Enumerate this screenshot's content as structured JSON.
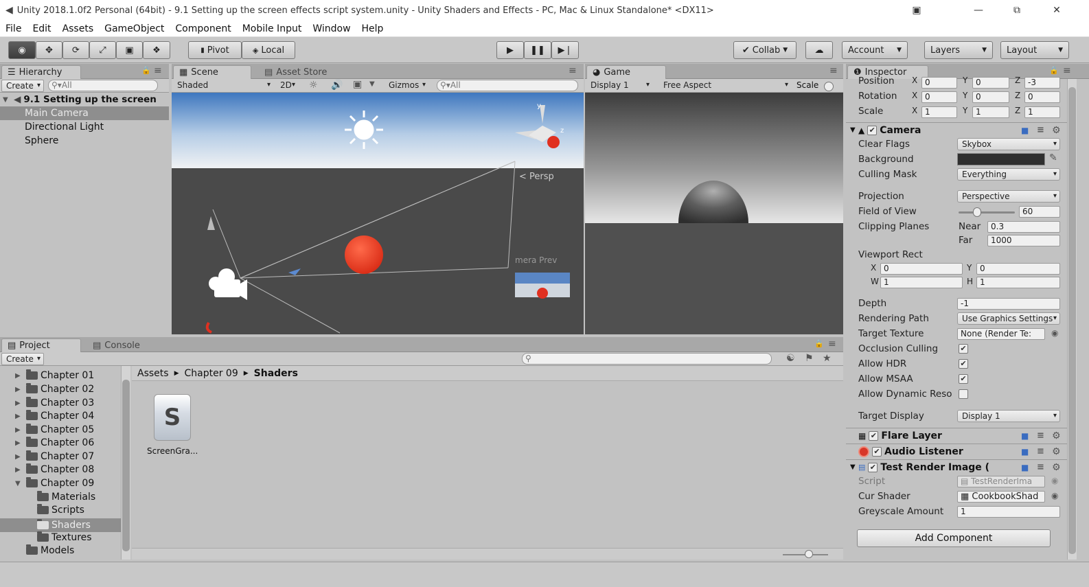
{
  "window": {
    "title": "Unity 2018.1.0f2 Personal (64bit) - 9.1 Setting up the screen effects script system.unity - Unity Shaders and Effects - PC, Mac & Linux Standalone* <DX11>"
  },
  "menu": [
    "File",
    "Edit",
    "Assets",
    "GameObject",
    "Component",
    "Mobile Input",
    "Window",
    "Help"
  ],
  "toolbar": {
    "pivot": "Pivot",
    "local": "Local",
    "collab": "Collab",
    "account": "Account",
    "layers": "Layers",
    "layout": "Layout"
  },
  "hierarchy": {
    "tab": "Hierarchy",
    "create": "Create",
    "search_placeholder": "All",
    "scene_name": "9.1 Setting up the screen",
    "items": [
      "Main Camera",
      "Directional Light",
      "Sphere"
    ]
  },
  "scene": {
    "tab": "Scene",
    "asset_store_tab": "Asset Store",
    "shading": "Shaded",
    "mode_2d": "2D",
    "gizmos": "Gizmos",
    "search_placeholder": "All",
    "persp_label": "Persp",
    "camera_preview_label": "mera Prev"
  },
  "game": {
    "tab": "Game",
    "display": "Display 1",
    "aspect": "Free Aspect",
    "scale": "Scale"
  },
  "inspector": {
    "tab": "Inspector",
    "transform": {
      "position_label": "Position",
      "position": [
        "0",
        "0",
        "-3"
      ],
      "rotation_label": "Rotation",
      "rotation": [
        "0",
        "0",
        "0"
      ],
      "scale_label": "Scale",
      "scale": [
        "1",
        "1",
        "1"
      ],
      "axis_labels": [
        "X",
        "Y",
        "Z"
      ]
    },
    "camera": {
      "title": "Camera",
      "clear_flags_label": "Clear Flags",
      "clear_flags": "Skybox",
      "background_label": "Background",
      "culling_mask_label": "Culling Mask",
      "culling_mask": "Everything",
      "projection_label": "Projection",
      "projection": "Perspective",
      "fov_label": "Field of View",
      "fov": "60",
      "fov_fraction": 0.33,
      "clipping_label": "Clipping Planes",
      "near_label": "Near",
      "near": "0.3",
      "far_label": "Far",
      "far": "1000",
      "viewport_label": "Viewport Rect",
      "vp_x_label": "X",
      "vp_x": "0",
      "vp_y_label": "Y",
      "vp_y": "0",
      "vp_w_label": "W",
      "vp_w": "1",
      "vp_h_label": "H",
      "vp_h": "1",
      "depth_label": "Depth",
      "depth": "-1",
      "rendering_path_label": "Rendering Path",
      "rendering_path": "Use Graphics Settings",
      "target_texture_label": "Target Texture",
      "target_texture": "None (Render Te:",
      "occlusion_label": "Occlusion Culling",
      "hdr_label": "Allow HDR",
      "msaa_label": "Allow MSAA",
      "dynres_label": "Allow Dynamic Reso",
      "target_display_label": "Target Display",
      "target_display": "Display 1"
    },
    "flare_layer": "Flare Layer",
    "audio_listener": "Audio Listener",
    "test_render": {
      "title": "Test Render Image (",
      "script_label": "Script",
      "script": "TestRenderIma",
      "cur_shader_label": "Cur Shader",
      "cur_shader": "CookbookShad",
      "greyscale_label": "Greyscale Amount",
      "greyscale": "1"
    },
    "add_component": "Add Component"
  },
  "project": {
    "tab": "Project",
    "console_tab": "Console",
    "create": "Create",
    "folders": [
      "Chapter 01",
      "Chapter 02",
      "Chapter 03",
      "Chapter 04",
      "Chapter 05",
      "Chapter 06",
      "Chapter 07",
      "Chapter 08",
      "Chapter 09"
    ],
    "subfolders": [
      "Materials",
      "Scripts",
      "Shaders",
      "Textures"
    ],
    "models": "Models",
    "breadcrumb": [
      "Assets",
      "Chapter 09",
      "Shaders"
    ],
    "asset_name": "ScreenGra...",
    "asset_glyph": "S"
  },
  "colors": {
    "accent_selected": "#8e8e8e",
    "scene_bg": "#4a4a4a",
    "sphere_red": "#e03020",
    "panel": "#c2c2c2"
  }
}
